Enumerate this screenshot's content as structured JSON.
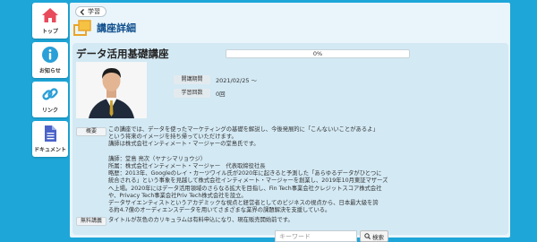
{
  "sidebar": {
    "items": [
      {
        "label": "トップ",
        "icon": "home-icon"
      },
      {
        "label": "お知らせ",
        "icon": "info-icon"
      },
      {
        "label": "リンク",
        "icon": "link-icon"
      },
      {
        "label": "ドキュメント",
        "icon": "document-icon"
      }
    ]
  },
  "header": {
    "back_label": "学習",
    "title": "講座詳細"
  },
  "course": {
    "name": "データ活用基礎講座",
    "progress_text": "0%",
    "progress_value": 0,
    "period_label": "開講期間",
    "period_value": "2021/02/25 〜",
    "count_label": "学習回数",
    "count_value": "0回",
    "overview_label": "概要",
    "free_label": "無料講義",
    "description": "この講座では、データを使ったマーケティングの基礎を解説し、今後発展的に「こんないいことがあるよ」\nという将来のイメージを持ち帰っていただけます。\n講師は株式会社インティメート・マージャーの堂島氏です。\n\n講師：堂島 亮次（ヤナシマリョウジ）\n所属：株式会社インティメート・マージャー　代表取締役社長\n略歴：2013年、Googleのレイ・カーツワイル氏が2020年に起きると予測した「あらゆるデータがひとつに\n統合される」という事象を見越して株式会社インティメート・マージャーを創業し、2019年10月東証マザーズ\nへ上場。2020年にはデータ活用領域のさらなる拡大を目指し、Fin Tech事業会社クレジットスコア株式会社\nや、Privacy Tech事業会社Priv Tech株式会社を設立。\nデータサイエンティストというアカデミックな視点と経営者としてのビジネスの視点から、日本最大級を誇\nる約4.7億のオーディエンスデータを用いてさまざまな業界の課題解決を支援している。",
    "free_text": "タイトルが灰色のカリキュラムは有料申込になり、現在販売開始前です。"
  },
  "search": {
    "placeholder": "キーワード",
    "button_label": "検索"
  },
  "colors": {
    "background": "#1ea6d8",
    "home": "#e84b5c",
    "info": "#2a9fd8",
    "link": "#2a9fd8",
    "document": "#4a63c8",
    "title": "#0d4d8c"
  }
}
